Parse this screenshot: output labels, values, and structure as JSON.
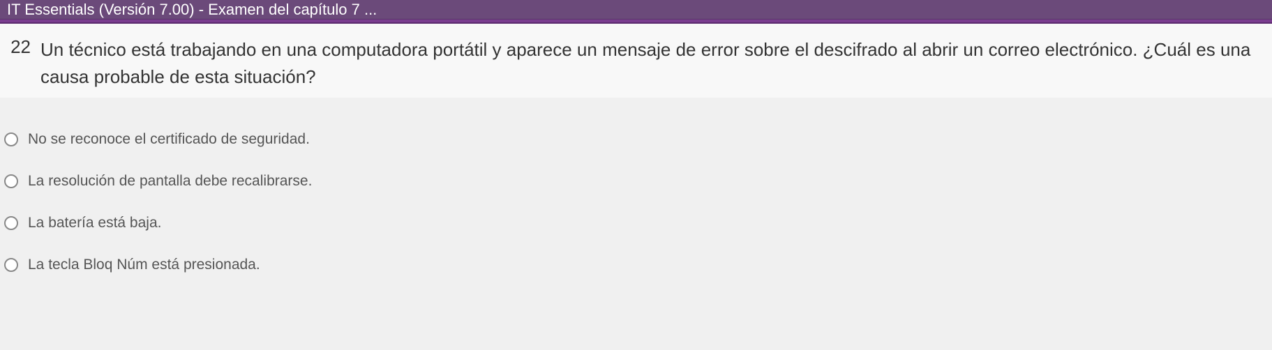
{
  "header": {
    "title": "IT Essentials (Versión 7.00) - Examen del capítulo 7 ..."
  },
  "question": {
    "number": "22",
    "text": "Un técnico está trabajando en una computadora portátil y aparece un mensaje de error sobre el descifrado al abrir un correo electrónico. ¿Cuál es una causa probable de esta situación?"
  },
  "options": [
    {
      "label": "No se reconoce el certificado de seguridad."
    },
    {
      "label": "La resolución de pantalla debe recalibrarse."
    },
    {
      "label": "La batería está baja."
    },
    {
      "label": "La tecla Bloq Núm está presionada."
    }
  ]
}
